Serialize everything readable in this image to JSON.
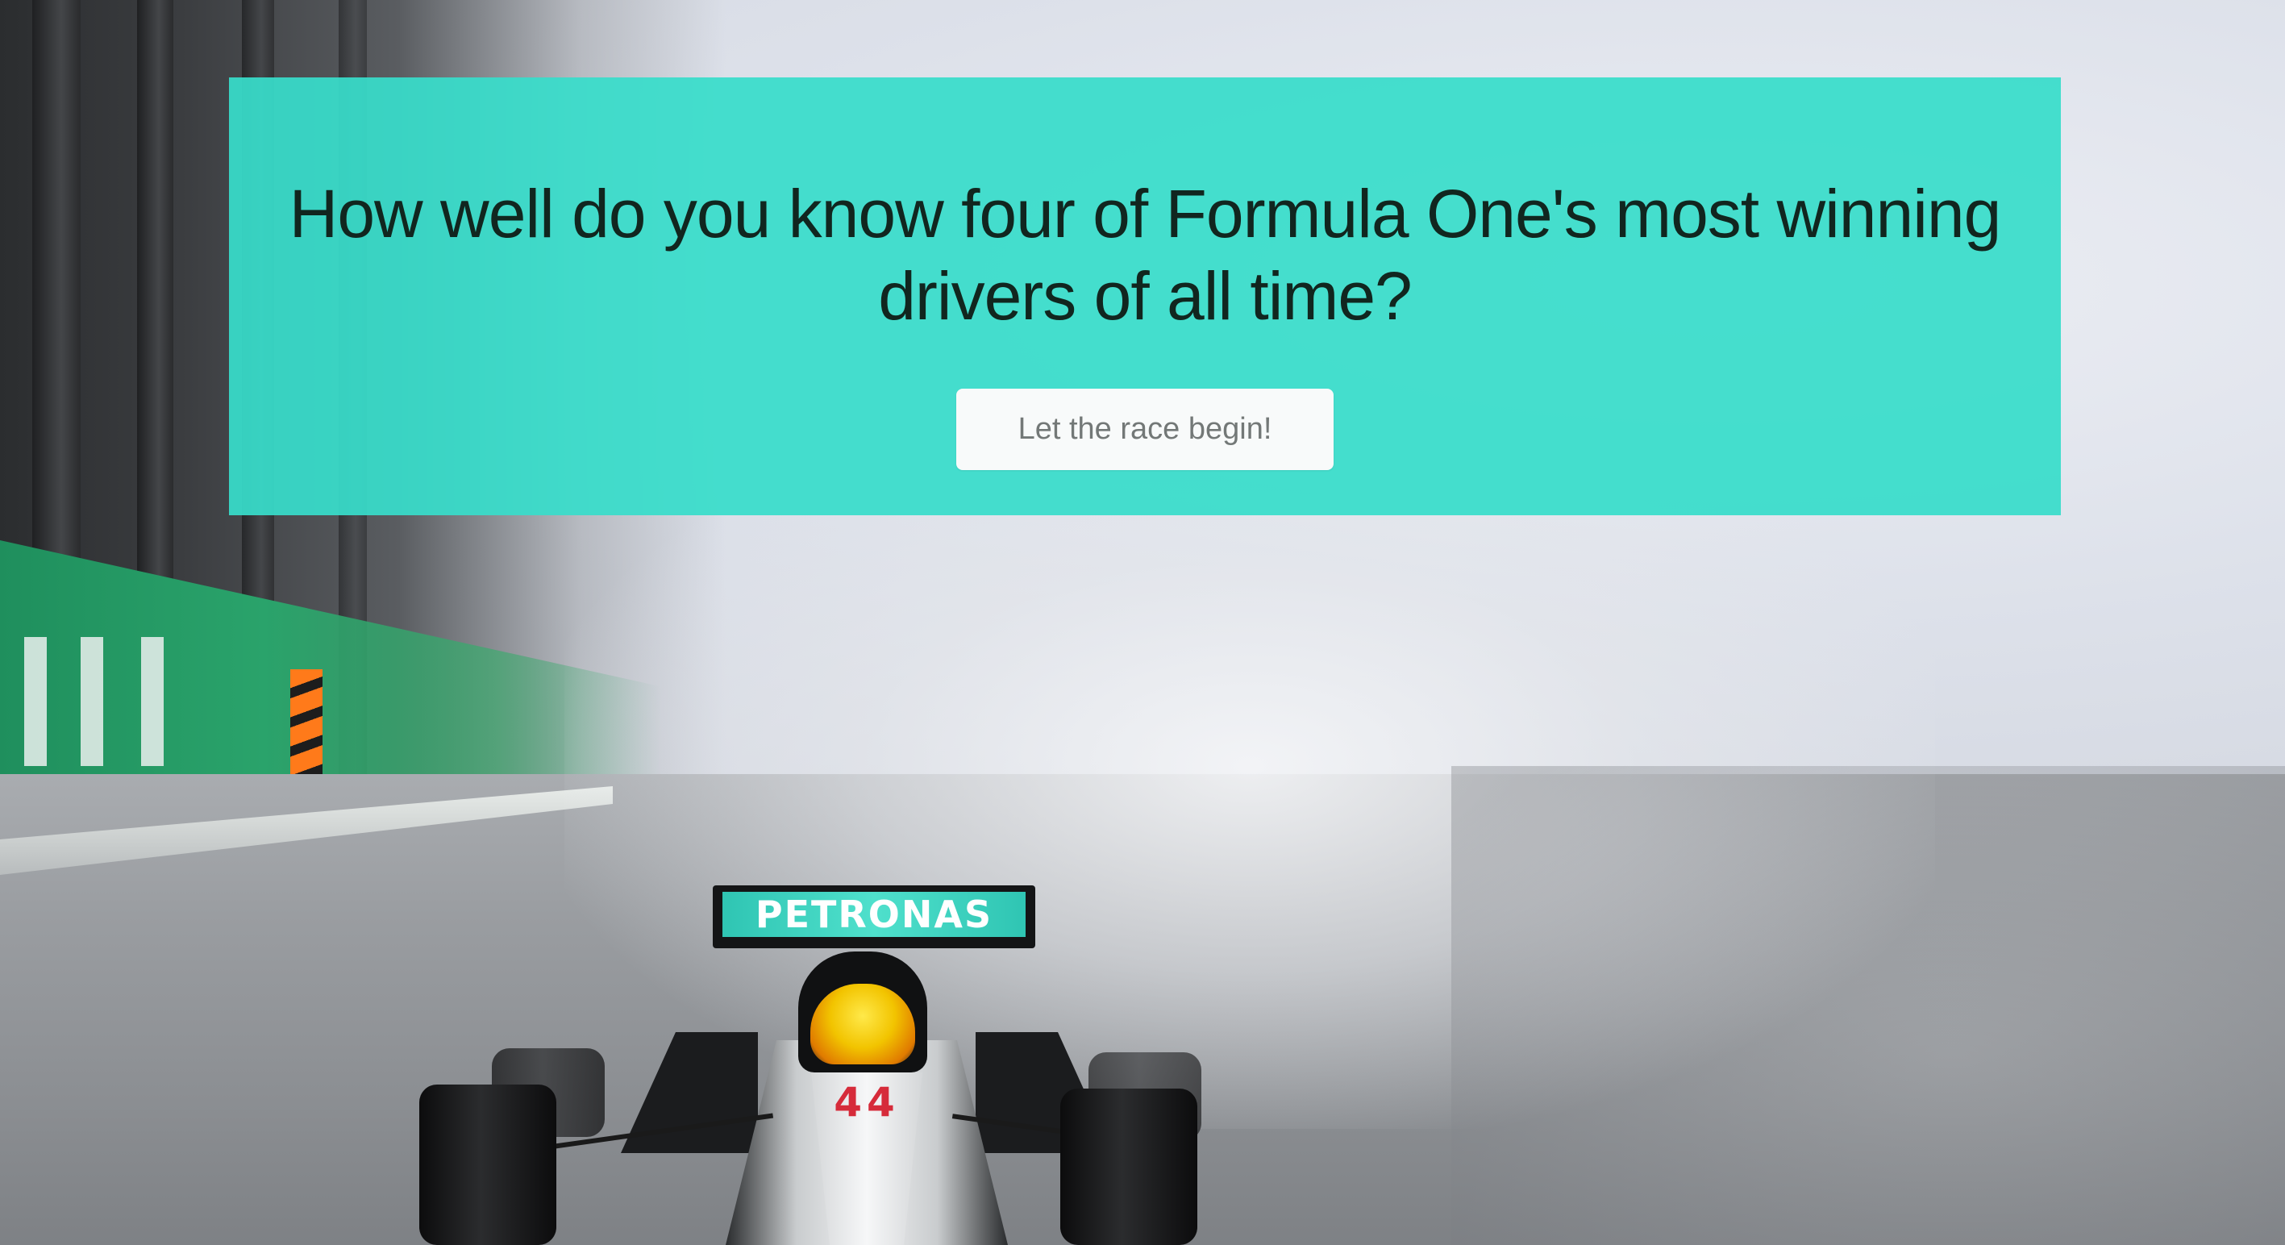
{
  "quiz_intro": {
    "title": "How well do you know four of Formula One's most winning drivers of all time?",
    "start_button_label": "Let the race begin!"
  },
  "background_image": {
    "rear_wing_text": "PETRONAS",
    "car_number": "44"
  },
  "colors": {
    "banner_background": "#38ddca",
    "title_text": "#11261f",
    "button_background": "#f8fafa",
    "button_text": "#737877"
  }
}
